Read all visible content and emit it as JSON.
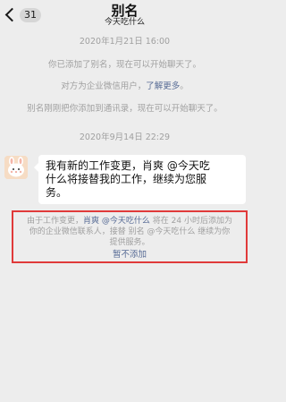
{
  "header": {
    "back_count": "31",
    "title": "别名",
    "subtitle": "今天吃什么"
  },
  "system_messages": {
    "timestamp_1": "2020年1月21日 16:00",
    "added_alias": "你已添加了别名，现在可以开始聊天了。",
    "wecom_prefix": "对方为企业微信用户，",
    "wecom_link": "了解更多",
    "wecom_suffix": "。",
    "alias_added_contacts": "别名刚刚把你添加到通讯录，现在可以开始聊天了。",
    "timestamp_2": "2020年9月14日 22:29"
  },
  "message": {
    "line_1": "我有新的工作变更，肖爽 @今天吃",
    "line_2": "什么将接替我的工作，继续为您服",
    "line_3": "务。"
  },
  "notice": {
    "line1_prefix": "由于工作变更，",
    "line1_link": "肖爽 @今天吃什么",
    "line1_suffix": " 将在 24 小时后添加为",
    "line2": "你的企业微信联系人，接替 别名 @今天吃什么 继续为你",
    "line3": "提供服务。",
    "action_label": "暂不添加"
  },
  "colors": {
    "background": "#ededed",
    "link": "#576b95",
    "highlight_border": "#e03a3a",
    "system_text": "#a0a0a0"
  },
  "icons": {
    "back": "chevron-left-icon",
    "avatar": "bunny-avatar"
  }
}
